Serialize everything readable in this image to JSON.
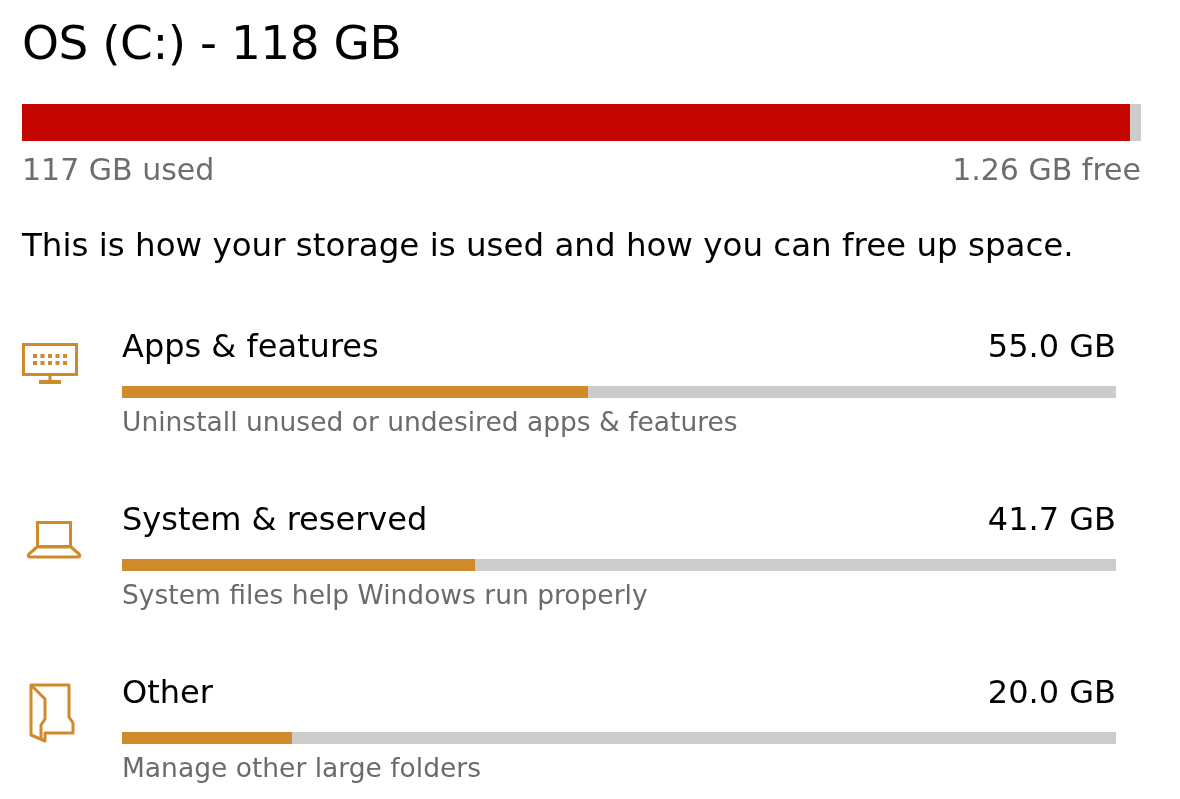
{
  "drive": {
    "title": "OS (C:) - 118 GB",
    "level": 0.99,
    "used": "117 GB used",
    "free": "1.26 GB free"
  },
  "description": "This is how your storage is used and how you can free up space.",
  "categories": [
    {
      "kind": "apps",
      "name": "Apps & features",
      "size": "55.0 GB",
      "level": 0.469,
      "hint": "Uninstall unused or undesired apps & features"
    },
    {
      "kind": "system",
      "name": "System & reserved",
      "size": "41.7 GB",
      "level": 0.355,
      "hint": "System files help Windows run properly"
    },
    {
      "kind": "other",
      "name": "Other",
      "size": "20.0 GB",
      "level": 0.171,
      "hint": "Manage other large folders"
    }
  ]
}
